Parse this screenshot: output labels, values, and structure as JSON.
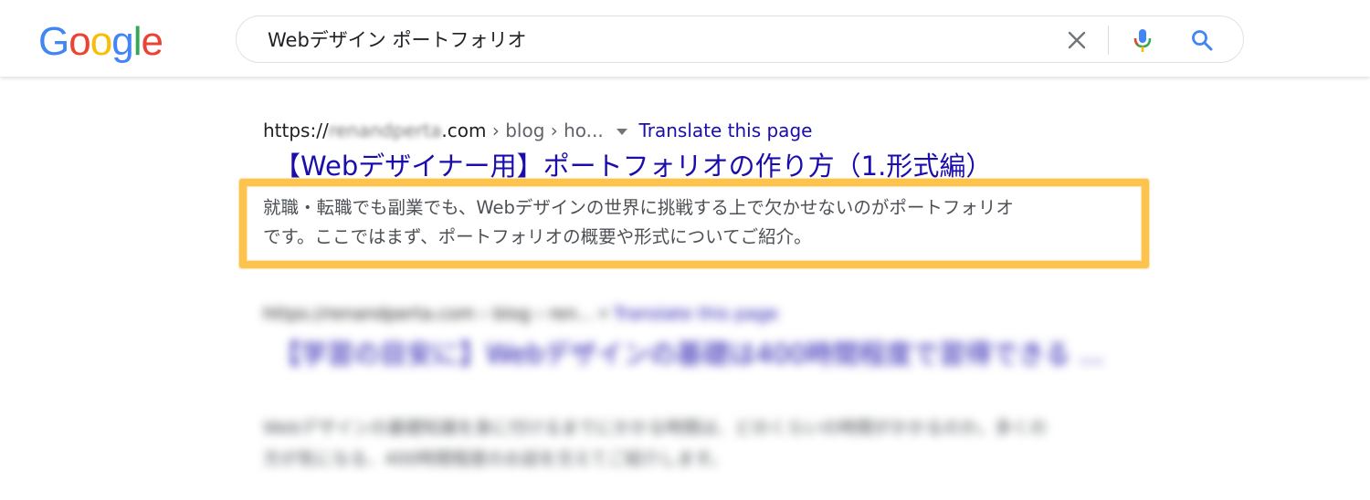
{
  "header": {
    "logo": {
      "letters": [
        "G",
        "o",
        "o",
        "g",
        "l",
        "e"
      ],
      "colors": [
        "#4285f4",
        "#ea4335",
        "#fbbc05",
        "#4285f4",
        "#34a853",
        "#ea4335"
      ]
    },
    "search": {
      "query": "Webデザイン ポートフォリオ",
      "clear_icon": "close-icon",
      "mic_icon": "microphone-icon",
      "search_icon": "search-icon"
    }
  },
  "results": [
    {
      "url_prefix": "https://",
      "url_domain_hidden": "renandperta",
      "url_suffix": ".com",
      "breadcrumb": "› blog › ho...",
      "translate": "Translate this page",
      "title": "【Webデザイナー用】ポートフォリオの作り方（1.形式編）",
      "snippet": [
        "就職・転職でも副業でも、Webデザインの世界に挑戦する上で欠かせないのがポートフォリオ",
        "です。ここではまず、ポートフォリオの概要や形式についてご紹介。"
      ],
      "highlight_color": "#fcc44f"
    },
    {
      "url": "https://renandperta.com › blog › ren...",
      "translate": "Translate this page",
      "title": "【学習の目安に】Webデザインの基礎は400時間程度で習得できる ...",
      "snippet": [
        "Webデザインの基礎知識を身に付けるまでにかかる時間は、どのくらいの時間がかかるのか。多くの",
        "方が気になる、400時間程度のお話を交えてご紹介します。"
      ]
    }
  ],
  "colors": {
    "link": "#1a0dab",
    "text": "#202124",
    "snippet": "#4d5156",
    "highlight": "#fcc44f"
  }
}
